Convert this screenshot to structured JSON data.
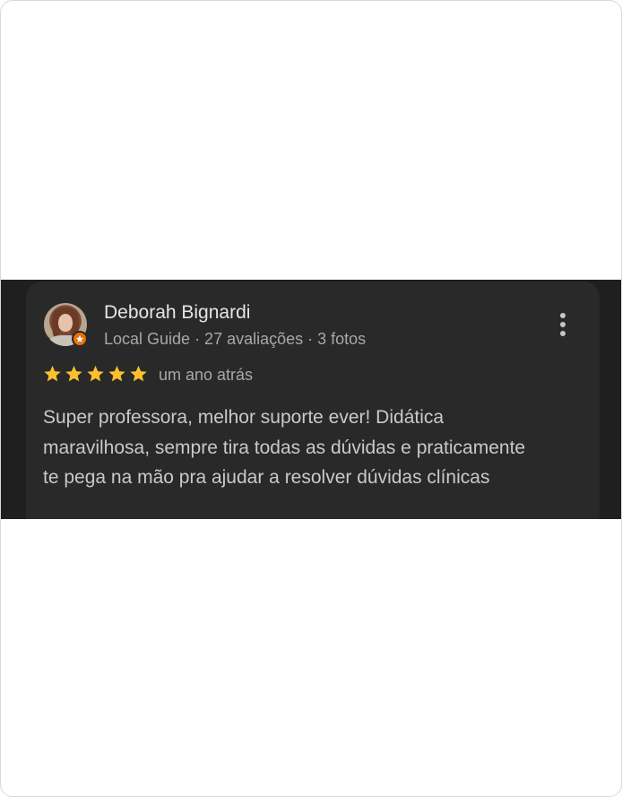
{
  "review": {
    "author_name": "Deborah Bignardi",
    "author_meta": "Local Guide · 27 avaliações · 3 fotos",
    "rating": 5,
    "rating_max": 5,
    "time_ago": "um ano atrás",
    "text": "Super professora, melhor suporte ever! Didática maravilhosa, sempre tira todas as dúvidas e praticamente te pega na mão pra ajudar a resolver dúvidas clínicas"
  },
  "colors": {
    "star": "#fbc02d",
    "local_guide_badge": "#e8710a",
    "card_background": "#292929",
    "band_background": "#1f1f1f"
  },
  "icons": {
    "more": "more-vert-icon",
    "star": "star-icon",
    "badge": "local-guide-badge-icon"
  }
}
